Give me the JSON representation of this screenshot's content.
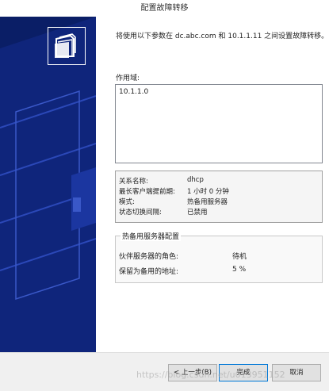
{
  "window": {
    "title": "配置故障转移"
  },
  "left_panel": {
    "icon": "folders-icon"
  },
  "content": {
    "intro": "将使用以下参数在 dc.abc.com 和 10.1.1.11 之间设置故障转移。",
    "scope_label": "作用域:",
    "scope_items": [
      "10.1.1.0"
    ],
    "summary": [
      {
        "key": "关系名称:",
        "value": "dhcp"
      },
      {
        "key": "最长客户端提前期:",
        "value": "1 小时 0 分钟"
      },
      {
        "key": "模式:",
        "value": "热备用服务器"
      },
      {
        "key": "状态切换间隔:",
        "value": "已禁用"
      }
    ],
    "hot_standby": {
      "title": "热备用服务器配置",
      "rows": [
        {
          "key": "伙伴服务器的角色:",
          "value": "待机"
        },
        {
          "key": "保留为备用的地址:",
          "value": "5 %"
        }
      ]
    }
  },
  "footer": {
    "back_label": "< 上一步(B)",
    "finish_label": "完成",
    "cancel_label": "取消"
  },
  "watermark": "https://blog.csdn.net/u013951152"
}
